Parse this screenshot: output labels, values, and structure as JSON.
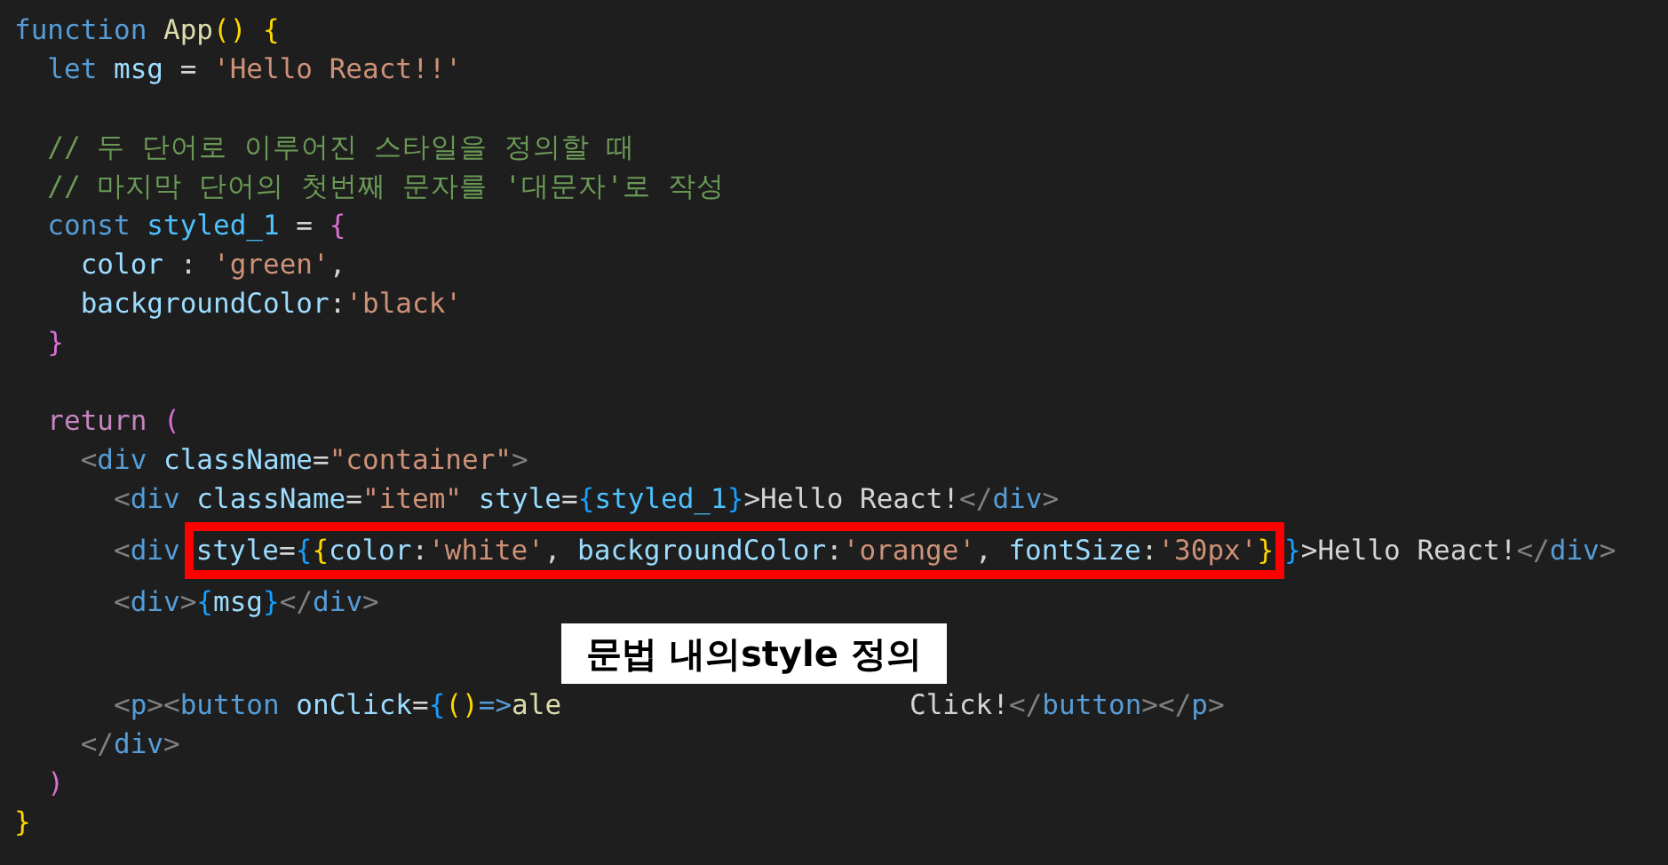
{
  "code_lines": [
    {
      "kind": "code",
      "segments": [
        {
          "kind": "code",
          "tokens": [
            {
              "t": "function ",
              "kind": "kw"
            },
            {
              "t": "App",
              "kind": "fn"
            },
            {
              "t": "() {",
              "kind": "b1"
            }
          ]
        }
      ]
    },
    {
      "kind": "code",
      "segments": [
        {
          "kind": "code",
          "tokens": [
            {
              "t": "  let ",
              "kind": "kw"
            },
            {
              "t": "msg",
              "kind": "var"
            },
            {
              "t": " = ",
              "kind": "p"
            },
            {
              "t": "'Hello React!!'",
              "kind": "str"
            }
          ]
        }
      ]
    },
    {
      "kind": "blank"
    },
    {
      "kind": "code",
      "segments": [
        {
          "kind": "code",
          "tokens": [
            {
              "t": "  // 두 단어로 이루어진 스타일을 정의할 때",
              "kind": "cm"
            }
          ]
        }
      ]
    },
    {
      "kind": "code",
      "segments": [
        {
          "kind": "code",
          "tokens": [
            {
              "t": "  // 마지막 단어의 첫번째 문자를 '대문자'로 작성",
              "kind": "cm"
            }
          ]
        }
      ]
    },
    {
      "kind": "code",
      "segments": [
        {
          "kind": "code",
          "tokens": [
            {
              "t": "  const ",
              "kind": "kw"
            },
            {
              "t": "styled_1",
              "kind": "cst"
            },
            {
              "t": " = ",
              "kind": "p"
            },
            {
              "t": "{",
              "kind": "b2"
            }
          ]
        }
      ]
    },
    {
      "kind": "code",
      "segments": [
        {
          "kind": "code",
          "tokens": [
            {
              "t": "    color",
              "kind": "var"
            },
            {
              "t": " : ",
              "kind": "p"
            },
            {
              "t": "'green'",
              "kind": "str"
            },
            {
              "t": ",",
              "kind": "p"
            }
          ]
        }
      ]
    },
    {
      "kind": "code",
      "segments": [
        {
          "kind": "code",
          "tokens": [
            {
              "t": "    backgroundColor",
              "kind": "var"
            },
            {
              "t": ":",
              "kind": "p"
            },
            {
              "t": "'black'",
              "kind": "str"
            }
          ]
        }
      ]
    },
    {
      "kind": "code",
      "segments": [
        {
          "kind": "code",
          "tokens": [
            {
              "t": "  }",
              "kind": "b2"
            }
          ]
        }
      ]
    },
    {
      "kind": "blank"
    },
    {
      "kind": "code",
      "segments": [
        {
          "kind": "code",
          "tokens": [
            {
              "t": "  return ",
              "kind": "ctl"
            },
            {
              "t": "(",
              "kind": "b2"
            }
          ]
        }
      ]
    },
    {
      "kind": "code",
      "segments": [
        {
          "kind": "code",
          "tokens": [
            {
              "t": "    <",
              "kind": "tg"
            },
            {
              "t": "div ",
              "kind": "kw"
            },
            {
              "t": "className",
              "kind": "var"
            },
            {
              "t": "=",
              "kind": "p"
            },
            {
              "t": "\"container\"",
              "kind": "str"
            },
            {
              "t": ">",
              "kind": "tg"
            }
          ]
        }
      ]
    },
    {
      "kind": "code",
      "segments": [
        {
          "kind": "code",
          "tokens": [
            {
              "t": "      <",
              "kind": "tg"
            },
            {
              "t": "div ",
              "kind": "kw"
            },
            {
              "t": "className",
              "kind": "var"
            },
            {
              "t": "=",
              "kind": "p"
            },
            {
              "t": "\"item\" ",
              "kind": "str"
            },
            {
              "t": "style",
              "kind": "var"
            },
            {
              "t": "=",
              "kind": "p"
            },
            {
              "t": "{",
              "kind": "b3"
            },
            {
              "t": "styled_1",
              "kind": "cst"
            },
            {
              "t": "}",
              "kind": "b3"
            },
            {
              "t": ">Hello React!",
              "kind": "p"
            },
            {
              "t": "</",
              "kind": "tg"
            },
            {
              "t": "div",
              "kind": "kw"
            },
            {
              "t": ">",
              "kind": "tg"
            }
          ]
        }
      ]
    },
    {
      "kind": "code",
      "segments": [
        {
          "kind": "code",
          "tokens": [
            {
              "t": "      <",
              "kind": "tg"
            },
            {
              "t": "div",
              "kind": "kw"
            }
          ]
        },
        {
          "kind": "highlight",
          "tokens": [
            {
              "t": "style",
              "kind": "var"
            },
            {
              "t": "=",
              "kind": "p"
            },
            {
              "t": "{",
              "kind": "b3"
            },
            {
              "t": "{",
              "kind": "b1"
            },
            {
              "t": "color",
              "kind": "var"
            },
            {
              "t": ":",
              "kind": "p"
            },
            {
              "t": "'white'",
              "kind": "str"
            },
            {
              "t": ", ",
              "kind": "p"
            },
            {
              "t": "backgroundColor",
              "kind": "var"
            },
            {
              "t": ":",
              "kind": "p"
            },
            {
              "t": "'orange'",
              "kind": "str"
            },
            {
              "t": ", ",
              "kind": "p"
            },
            {
              "t": "fontSize",
              "kind": "var"
            },
            {
              "t": ":",
              "kind": "p"
            },
            {
              "t": "'30px'",
              "kind": "str"
            },
            {
              "t": "}",
              "kind": "b1"
            }
          ]
        },
        {
          "kind": "code",
          "tokens": [
            {
              "t": "}",
              "kind": "b3"
            },
            {
              "t": ">Hello React!",
              "kind": "p"
            },
            {
              "t": "</",
              "kind": "tg"
            },
            {
              "t": "div",
              "kind": "kw"
            },
            {
              "t": ">",
              "kind": "tg"
            }
          ]
        }
      ]
    },
    {
      "kind": "code",
      "segments": [
        {
          "kind": "code",
          "tokens": [
            {
              "t": "      <",
              "kind": "tg"
            },
            {
              "t": "div",
              "kind": "kw"
            },
            {
              "t": ">",
              "kind": "tg"
            },
            {
              "t": "{",
              "kind": "b3"
            },
            {
              "t": "msg",
              "kind": "var"
            },
            {
              "t": "}",
              "kind": "b3"
            },
            {
              "t": "</",
              "kind": "tg"
            },
            {
              "t": "div",
              "kind": "kw"
            },
            {
              "t": ">",
              "kind": "tg"
            }
          ]
        }
      ]
    },
    {
      "kind": "annotation",
      "label": "문법 내의style 정의"
    },
    {
      "kind": "code",
      "segments": [
        {
          "kind": "code",
          "tokens": [
            {
              "t": "      <",
              "kind": "tg"
            },
            {
              "t": "p",
              "kind": "kw"
            },
            {
              "t": "><",
              "kind": "tg"
            },
            {
              "t": "button ",
              "kind": "kw"
            },
            {
              "t": "onClick",
              "kind": "var"
            },
            {
              "t": "=",
              "kind": "p"
            },
            {
              "t": "{",
              "kind": "b3"
            },
            {
              "t": "()",
              "kind": "b1"
            },
            {
              "t": "=>",
              "kind": "kw"
            },
            {
              "t": "ale",
              "kind": "fn"
            }
          ]
        },
        {
          "kind": "resume",
          "tokens": [
            {
              "t": "Click!",
              "kind": "p"
            },
            {
              "t": "</",
              "kind": "tg"
            },
            {
              "t": "button",
              "kind": "kw"
            },
            {
              "t": "></",
              "kind": "tg"
            },
            {
              "t": "p",
              "kind": "kw"
            },
            {
              "t": ">",
              "kind": "tg"
            }
          ]
        }
      ]
    },
    {
      "kind": "code",
      "segments": [
        {
          "kind": "code",
          "tokens": [
            {
              "t": "    </",
              "kind": "tg"
            },
            {
              "t": "div",
              "kind": "kw"
            },
            {
              "t": ">",
              "kind": "tg"
            }
          ]
        }
      ]
    },
    {
      "kind": "code",
      "segments": [
        {
          "kind": "code",
          "tokens": [
            {
              "t": "  )",
              "kind": "b2"
            }
          ]
        }
      ]
    },
    {
      "kind": "code",
      "segments": [
        {
          "kind": "code",
          "tokens": [
            {
              "t": "}",
              "kind": "b1"
            }
          ]
        }
      ]
    }
  ]
}
